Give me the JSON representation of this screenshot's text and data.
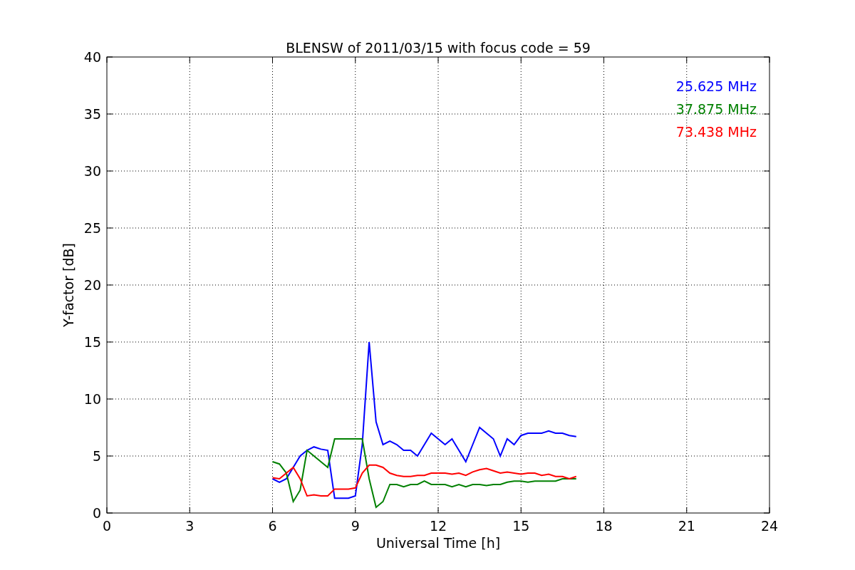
{
  "figure": {
    "chart_data": {
      "type": "line",
      "title": "BLENSW of 2011/03/15 with focus code = 59",
      "xlabel": "Universal Time [h]",
      "ylabel": "Y-factor [dB]",
      "x": [
        6,
        6.25,
        6.5,
        6.75,
        7,
        7.25,
        7.5,
        7.75,
        8,
        8.25,
        8.5,
        8.75,
        9,
        9.25,
        9.5,
        9.75,
        10,
        10.25,
        10.5,
        10.75,
        11,
        11.25,
        11.5,
        11.75,
        12,
        12.25,
        12.5,
        12.75,
        13,
        13.25,
        13.5,
        13.75,
        14,
        14.25,
        14.5,
        14.75,
        15,
        15.25,
        15.5,
        15.75,
        16,
        16.25,
        16.5,
        16.75,
        17
      ],
      "series": [
        {
          "name": "25.625 MHz",
          "color": "#0000ff",
          "values": [
            3.0,
            2.7,
            3.0,
            4.0,
            5.0,
            5.5,
            5.8,
            5.6,
            5.5,
            1.3,
            1.3,
            1.3,
            1.5,
            6.0,
            15.0,
            8.0,
            6.0,
            6.3,
            6.0,
            5.5,
            5.5,
            5.0,
            6.0,
            7.0,
            6.5,
            6.0,
            6.5,
            5.5,
            4.5,
            6.0,
            7.5,
            7.0,
            6.5,
            5.0,
            6.5,
            6.0,
            6.8,
            7.0,
            7.0,
            7.0,
            7.2,
            7.0,
            7.0,
            6.8,
            6.7
          ]
        },
        {
          "name": "37.875 MHz",
          "color": "#008000",
          "values": [
            4.5,
            4.3,
            3.5,
            1.0,
            2.0,
            5.5,
            5.0,
            4.5,
            4.0,
            6.5,
            6.5,
            6.5,
            6.5,
            6.5,
            3.0,
            0.5,
            1.0,
            2.5,
            2.5,
            2.3,
            2.5,
            2.5,
            2.8,
            2.5,
            2.5,
            2.5,
            2.3,
            2.5,
            2.3,
            2.5,
            2.5,
            2.4,
            2.5,
            2.5,
            2.7,
            2.8,
            2.8,
            2.7,
            2.8,
            2.8,
            2.8,
            2.8,
            3.0,
            3.0,
            3.0
          ]
        },
        {
          "name": "73.438 MHz",
          "color": "#ff0000",
          "values": [
            3.1,
            3.0,
            3.5,
            4.0,
            3.0,
            1.5,
            1.6,
            1.5,
            1.5,
            2.1,
            2.1,
            2.1,
            2.2,
            3.5,
            4.2,
            4.2,
            4.0,
            3.5,
            3.3,
            3.2,
            3.2,
            3.3,
            3.3,
            3.5,
            3.5,
            3.5,
            3.4,
            3.5,
            3.3,
            3.6,
            3.8,
            3.9,
            3.7,
            3.5,
            3.6,
            3.5,
            3.4,
            3.5,
            3.5,
            3.3,
            3.4,
            3.2,
            3.2,
            3.0,
            3.2
          ]
        }
      ],
      "xlim": [
        0,
        24
      ],
      "ylim": [
        0,
        40
      ],
      "xticks": [
        0,
        3,
        6,
        9,
        12,
        15,
        18,
        21,
        24
      ],
      "yticks": [
        0,
        5,
        10,
        15,
        20,
        25,
        30,
        35,
        40
      ],
      "grid": true
    }
  }
}
